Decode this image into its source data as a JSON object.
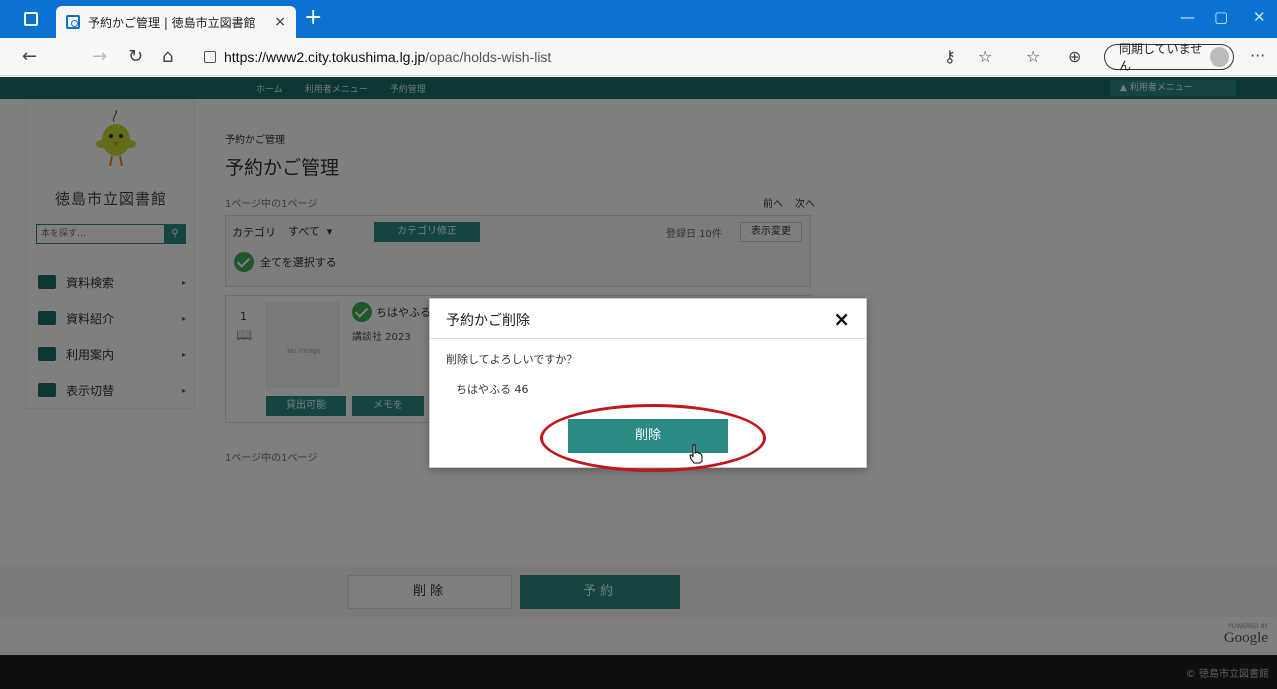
{
  "browser": {
    "tab_title": "予約かご管理 | 徳島市立図書館",
    "tab_close": "×",
    "new_tab": "+",
    "url_host": "https://www2.city.tokushima.lg.jp",
    "url_path": "/opac/holds-wish-list",
    "sync_label": "同期していません",
    "more": "···"
  },
  "site_nav": {
    "crumbs": [
      "ホーム",
      "利用者メニュー",
      "予約管理"
    ],
    "user_menu": "利用者メニュー"
  },
  "sidebar": {
    "library_name": "徳島市立図書館",
    "search_placeholder": "本を探す…",
    "menu": [
      {
        "label": "資料検索"
      },
      {
        "label": "資料紹介"
      },
      {
        "label": "利用案内"
      },
      {
        "label": "表示切替"
      }
    ]
  },
  "main": {
    "breadcrumb": "予約かご管理",
    "title": "予約かご管理",
    "page_info": "1ページ中の1ページ",
    "prev": "前へ",
    "next": "次へ",
    "category_label": "カテゴリ",
    "category_value": "すべて",
    "category_button": "カテゴリ修正",
    "sort_label": "登録日 10件",
    "sort_button": "表示変更",
    "select_all": "全てを選択する",
    "item": {
      "number": "1",
      "cover_text": "No Image",
      "title": "ちはやふる",
      "publisher": "講談社 2023",
      "btn_status": "貸出可能",
      "btn_memo": "メモを"
    },
    "page_info_bottom": "1ページ中の1ページ"
  },
  "action_bar": {
    "delete": "削除",
    "reserve": "予約"
  },
  "footer": {
    "powered_by": "POWERED BY",
    "google": "Google",
    "copyright": "© 徳島市立図書館"
  },
  "modal": {
    "title": "予約かご削除",
    "close": "×",
    "message": "削除してよろしいですか？",
    "item_name": "ちはやふる 46",
    "confirm_button": "削除"
  },
  "colors": {
    "browser_blue": "#0a72d1",
    "teal": "#2b8a84",
    "highlight": "#c0161c"
  }
}
